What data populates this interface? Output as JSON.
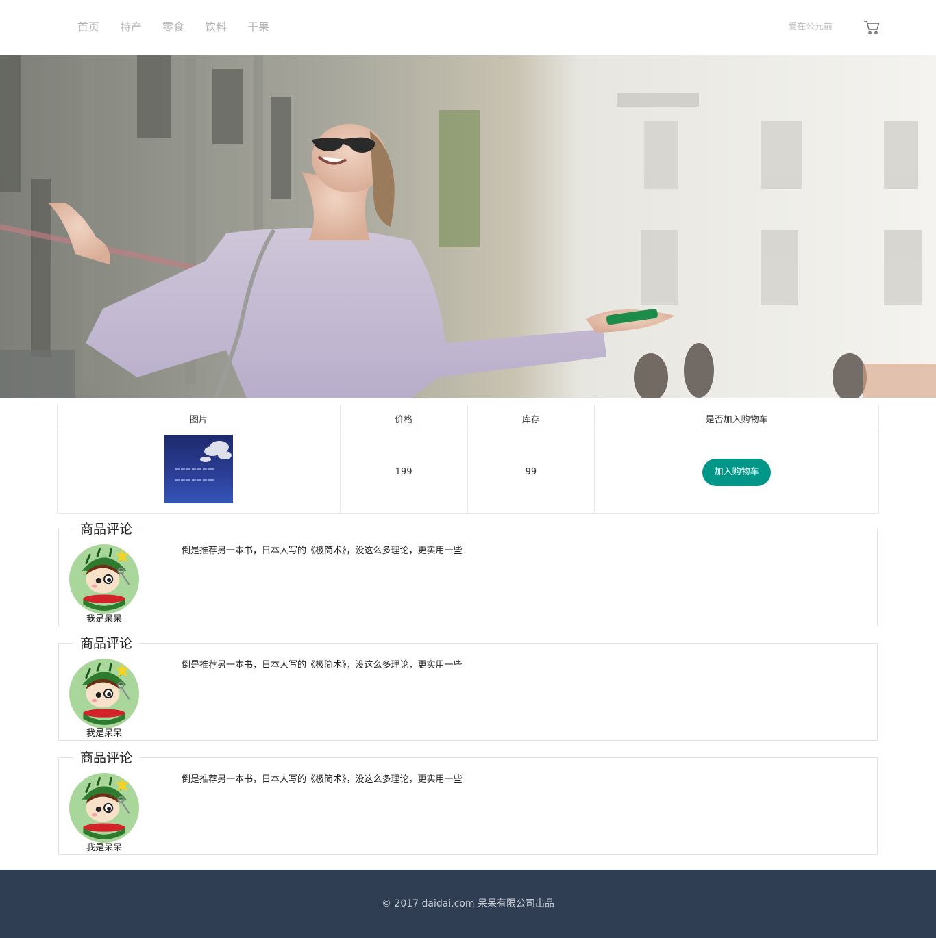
{
  "header": {
    "nav": [
      {
        "label": "首页"
      },
      {
        "label": "特产"
      },
      {
        "label": "零食"
      },
      {
        "label": "饮料"
      },
      {
        "label": "干果"
      }
    ],
    "user_label": "爱在公元前",
    "cart_icon": "shopping-cart-icon"
  },
  "product_table": {
    "headers": {
      "image": "图片",
      "price": "价格",
      "stock": "库存",
      "add_to_cart": "是否加入购物车"
    },
    "row": {
      "thumbnail_icon": "product-thumbnail",
      "price": "199",
      "stock": "99",
      "button_label": "加入购物车"
    }
  },
  "reviews": [
    {
      "title": "商品评论",
      "username": "我是呆呆",
      "text": "倒是推荐另一本书，日本人写的《极简术》，没这么多理论，更实用一些"
    },
    {
      "title": "商品评论",
      "username": "我是呆呆",
      "text": "倒是推荐另一本书，日本人写的《极简术》，没这么多理论，更实用一些"
    },
    {
      "title": "商品评论",
      "username": "我是呆呆",
      "text": "倒是推荐另一本书，日本人写的《极简术》，没这么多理论，更实用一些"
    }
  ],
  "footer": {
    "text": "© 2017 daidai.com 呆呆有限公司出品"
  },
  "colors": {
    "accent": "#009688",
    "footer_bg": "#2f3e53",
    "nav_text": "#b3b3b3"
  }
}
